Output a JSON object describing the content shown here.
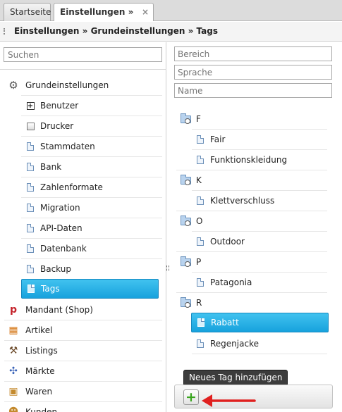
{
  "tabs": [
    {
      "label": "Startseite"
    },
    {
      "label": "Einstellungen » Tags",
      "close": "×"
    }
  ],
  "breadcrumb": "Einstellungen » Grundeinstellungen » Tags",
  "left": {
    "search_placeholder": "Suchen",
    "root": {
      "label": "Grundeinstellungen",
      "icon": "gear-icon"
    },
    "children": [
      {
        "label": "Benutzer",
        "icon": "plus-box-icon"
      },
      {
        "label": "Drucker",
        "icon": "checkbox-icon"
      },
      {
        "label": "Stammdaten",
        "icon": "document-icon"
      },
      {
        "label": "Bank",
        "icon": "document-icon"
      },
      {
        "label": "Zahlenformate",
        "icon": "document-icon"
      },
      {
        "label": "Migration",
        "icon": "document-icon"
      },
      {
        "label": "API-Daten",
        "icon": "document-icon"
      },
      {
        "label": "Datenbank",
        "icon": "document-icon"
      },
      {
        "label": "Backup",
        "icon": "document-icon"
      },
      {
        "label": "Tags",
        "icon": "document-icon",
        "selected": true
      }
    ],
    "roots": [
      {
        "label": "Mandant (Shop)",
        "icon": "mandant-icon"
      },
      {
        "label": "Artikel",
        "icon": "cubes-icon"
      },
      {
        "label": "Listings",
        "icon": "gavel-icon"
      },
      {
        "label": "Märkte",
        "icon": "network-icon"
      },
      {
        "label": "Waren",
        "icon": "boxes-icon"
      },
      {
        "label": "Kunden",
        "icon": "users-icon"
      }
    ]
  },
  "right": {
    "filters": {
      "area": "Bereich",
      "language": "Sprache",
      "name": "Name"
    },
    "groups": [
      {
        "letter": "F",
        "items": [
          "Fair",
          "Funktionskleidung"
        ]
      },
      {
        "letter": "K",
        "items": [
          "Klettverschluss"
        ]
      },
      {
        "letter": "O",
        "items": [
          "Outdoor"
        ]
      },
      {
        "letter": "P",
        "items": [
          "Patagonia"
        ]
      },
      {
        "letter": "R",
        "items": [
          "Rabatt",
          "Regenjacke"
        ]
      }
    ],
    "selected_tag": "Rabatt",
    "tooltip": "Neues Tag hinzufügen",
    "add_symbol": "+"
  },
  "colors": {
    "selection": "#1ea9e1",
    "arrow": "#e0201f",
    "add": "#39a51e"
  }
}
